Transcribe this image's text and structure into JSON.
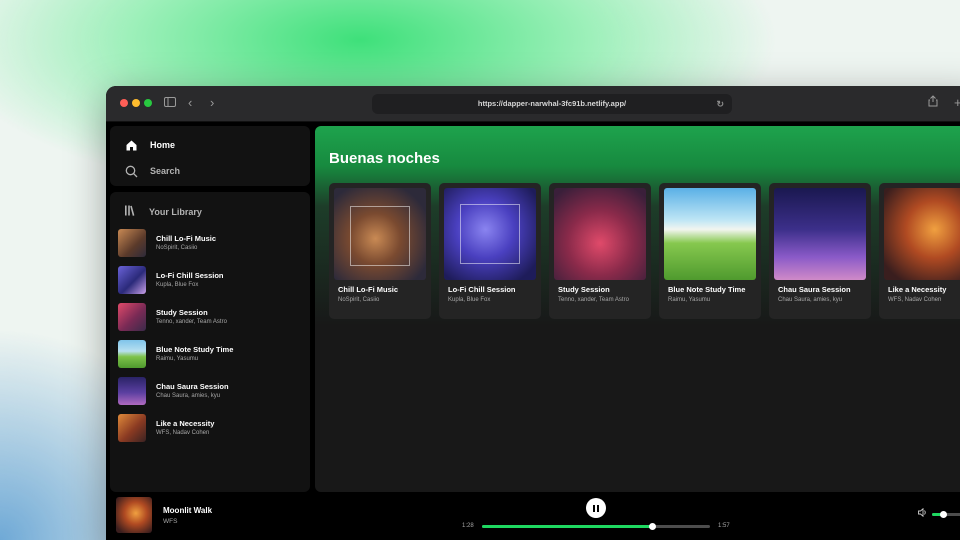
{
  "browser": {
    "url": "https://dapper-narwhal-3fc91b.netlify.app/"
  },
  "nav": {
    "home": "Home",
    "search": "Search",
    "library": "Your Library"
  },
  "library": [
    {
      "title": "Chill Lo-Fi Music",
      "artists": "NoSpirit, Casiio"
    },
    {
      "title": "Lo-Fi Chill Session",
      "artists": "Kupla, Blue Fox"
    },
    {
      "title": "Study Session",
      "artists": "Tenno, xander, Team Astro"
    },
    {
      "title": "Blue Note Study Time",
      "artists": "Raimu, Yasumu"
    },
    {
      "title": "Chau Saura Session",
      "artists": "Chau Saura, amies, kyu"
    },
    {
      "title": "Like a Necessity",
      "artists": "WFS, Nadav Cohen"
    }
  ],
  "main": {
    "greeting": "Buenas noches",
    "cards": [
      {
        "title": "Chill Lo-Fi Music",
        "artists": "NoSpirit, Casiio"
      },
      {
        "title": "Lo-Fi Chill Session",
        "artists": "Kupla, Blue Fox"
      },
      {
        "title": "Study Session",
        "artists": "Tenno, xander, Team Astro"
      },
      {
        "title": "Blue Note Study Time",
        "artists": "Raimu, Yasumu"
      },
      {
        "title": "Chau Saura Session",
        "artists": "Chau Saura, amies, kyu"
      },
      {
        "title": "Like a Necessity",
        "artists": "WFS, Nadav Cohen"
      }
    ]
  },
  "player": {
    "title": "Moonlit Walk",
    "artist": "WFS",
    "elapsed": "1:28",
    "duration": "1:57",
    "progress_fraction": 0.75,
    "volume_fraction": 0.3
  },
  "colors": {
    "accent": "#1ed760",
    "header_green": "#1ea34d",
    "panel": "#121212"
  },
  "icons": [
    "home-icon",
    "search-icon",
    "library-icon",
    "sidebar-toggle-icon",
    "back-icon",
    "forward-icon",
    "reload-icon",
    "share-icon",
    "new-tab-icon",
    "pause-icon",
    "volume-icon"
  ]
}
